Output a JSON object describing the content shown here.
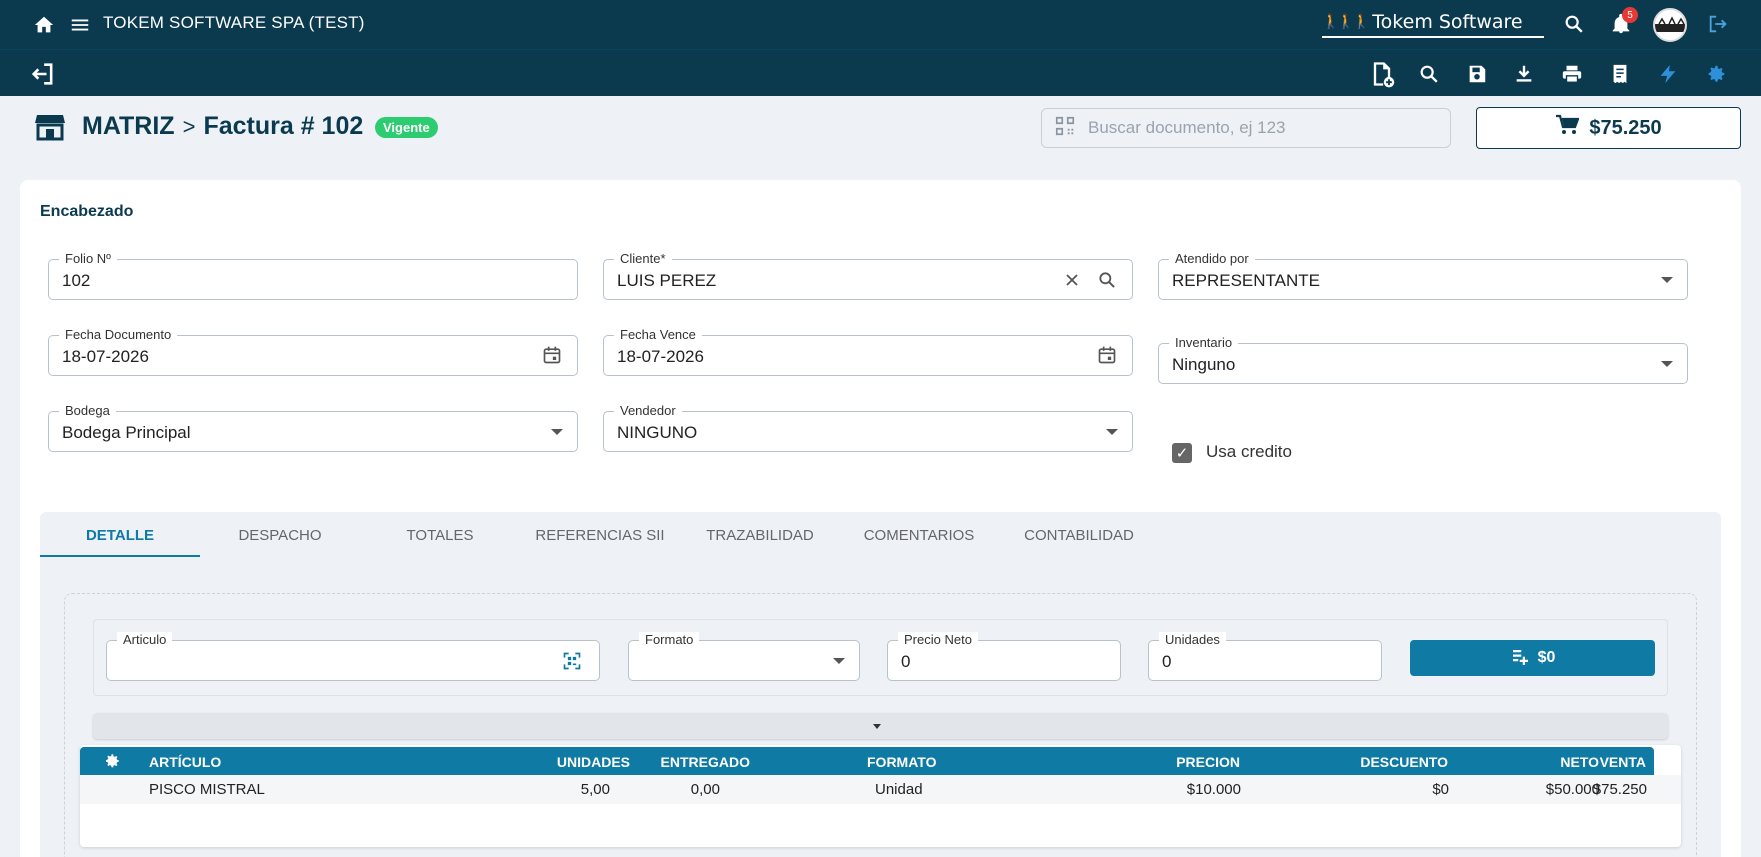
{
  "topbar": {
    "company": "TOKEM SOFTWARE SPA (TEST)",
    "brand": "Tokem Software",
    "notifications_count": "5",
    "icons": [
      "home-icon",
      "menu-icon",
      "search-icon",
      "bell-icon",
      "avatar",
      "logout-icon"
    ]
  },
  "toolbar": {
    "icons": [
      "back-icon",
      "new-document-icon",
      "search-icon",
      "save-icon",
      "download-icon",
      "print-icon",
      "receipt-icon",
      "lightning-icon",
      "settings-icon"
    ]
  },
  "header": {
    "branch": "MATRIZ",
    "separator": ">",
    "document": "Factura # 102",
    "status": "Vigente",
    "search_placeholder": "Buscar documento, ej 123",
    "cart_total": "$75.250"
  },
  "encabezado": {
    "title": "Encabezado",
    "folio_label": "Folio Nº",
    "folio_value": "102",
    "cliente_label": "Cliente*",
    "cliente_value": "LUIS PEREZ",
    "atendido_label": "Atendido por",
    "atendido_value": "REPRESENTANTE",
    "fecha_doc_label": "Fecha Documento",
    "fecha_doc_value": "18-07-2026",
    "fecha_vence_label": "Fecha Vence",
    "fecha_vence_value": "18-07-2026",
    "inventario_label": "Inventario",
    "inventario_value": "Ninguno",
    "bodega_label": "Bodega",
    "bodega_value": "Bodega Principal",
    "vendedor_label": "Vendedor",
    "vendedor_value": "NINGUNO",
    "usa_credito_label": "Usa credito",
    "usa_credito_checked": true
  },
  "tabs": [
    "DETALLE",
    "DESPACHO",
    "TOTALES",
    "REFERENCIAS SII",
    "TRAZABILIDAD",
    "COMENTARIOS",
    "CONTABILIDAD"
  ],
  "entry": {
    "articulo_label": "Articulo",
    "articulo_value": "",
    "formato_label": "Formato",
    "formato_value": "",
    "precio_label": "Precio Neto",
    "precio_value": "0",
    "unidades_label": "Unidades",
    "unidades_value": "0",
    "add_label": "$0"
  },
  "table": {
    "headers": [
      "ARTÍCULO",
      "UNIDADES",
      "ENTREGADO",
      "FORMATO",
      "PRECION",
      "DESCUENTO",
      "NETO",
      "VENTA"
    ],
    "rows": [
      [
        "PISCO MISTRAL",
        "5,00",
        "0,00",
        "Unidad",
        "$10.000",
        "$0",
        "$50.000",
        "$75.250"
      ]
    ]
  },
  "colors": {
    "navbar": "#0b3a4f",
    "accent": "#0f7aa3",
    "status_green": "#2ecc71",
    "badge_red": "#e53935"
  }
}
